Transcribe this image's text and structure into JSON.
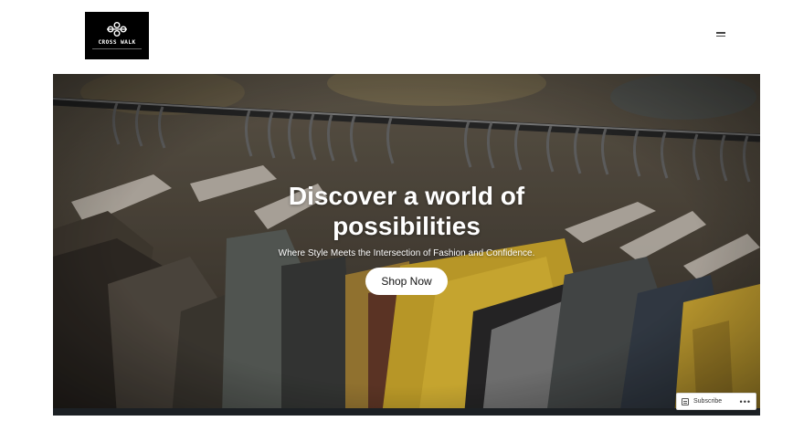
{
  "header": {
    "logo_text": "CROSS WALK",
    "menu_icon": "hamburger-menu-icon"
  },
  "hero": {
    "title": "Discover a world of possibilities",
    "subtitle": "Where Style Meets the Intersection of Fashion and Confidence.",
    "cta_label": "Shop Now",
    "image_subject": "clothes on hangers on a rack"
  },
  "subscribe_widget": {
    "label": "Subscribe",
    "more_label": "•••",
    "icon": "subscribe-reader-icon"
  },
  "colors": {
    "logo_background": "#000000",
    "hero_text": "#ffffff",
    "button_background": "#ffffff",
    "hero_bottom_bar": "#1c2024"
  }
}
